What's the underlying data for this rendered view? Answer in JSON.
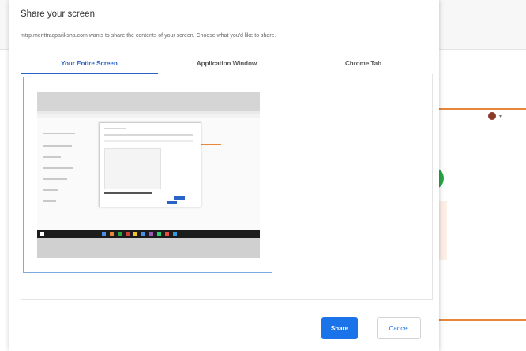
{
  "dialog": {
    "title": "Share your screen",
    "subtitle": "mtrp.merittracpariksha.com wants to share the contents of your screen. Choose what you'd like to share."
  },
  "tabs": [
    {
      "label": "Your Entire Screen",
      "active": true
    },
    {
      "label": "Application Window",
      "active": false
    },
    {
      "label": "Chrome Tab",
      "active": false
    }
  ],
  "buttons": {
    "share_label": "Share",
    "cancel_label": "Cancel"
  },
  "colors": {
    "accent": "#1a73e8",
    "tab_active": "#2a63c6",
    "orange_line": "#e8873a",
    "green_status": "#29a745"
  },
  "icons": {
    "avatar": "user-avatar",
    "caret": "chevron-down-icon"
  }
}
